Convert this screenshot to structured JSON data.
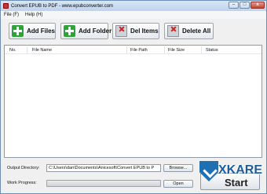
{
  "window": {
    "title": "Convert EPUB to PDF - www.epubconverter.com",
    "controls": {
      "minimize": "–",
      "maximize": "□",
      "close": "x"
    }
  },
  "menu": [
    {
      "label": "File (F)"
    },
    {
      "label": "Help (H)"
    }
  ],
  "toolbar": {
    "add_files": {
      "label": "Add Files",
      "icon": "plus-icon"
    },
    "add_folder": {
      "label": "Add Folder",
      "icon": "plus-icon"
    },
    "del_items": {
      "label": "Del Items",
      "icon": "delete-icon"
    },
    "delete_all": {
      "label": "Delete All",
      "icon": "delete-icon"
    }
  },
  "file_list": {
    "columns": [
      "No.",
      "File Name",
      "File Path",
      "File Size",
      "Status"
    ],
    "rows": []
  },
  "output": {
    "label": "Output Directory:",
    "value": "C:\\Users\\dan\\Documents\\Anicesoft\\Convert EPUB to P",
    "browse_label": "Browse..."
  },
  "progress": {
    "label": "Work Progress:",
    "value": 0,
    "open_label": "Open"
  },
  "start": {
    "label": "Start"
  },
  "watermark": {
    "text": "XKARE"
  }
}
